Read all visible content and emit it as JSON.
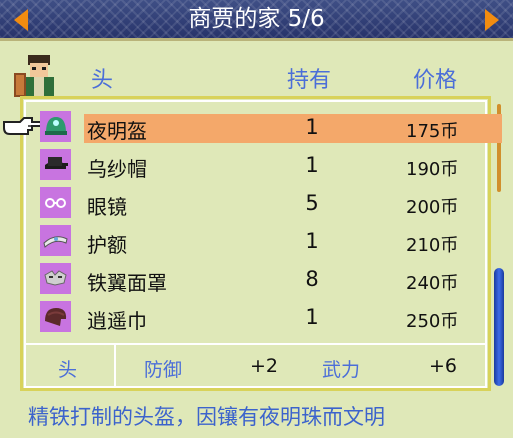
{
  "title": "商贾的家 5/6",
  "header": {
    "category": "头",
    "have_label": "持有",
    "price_label": "价格"
  },
  "items": [
    {
      "name": "夜明盔",
      "qty": "1",
      "price": "175",
      "unit": "币",
      "icon": "helmet-icon",
      "selected": true
    },
    {
      "name": "乌纱帽",
      "qty": "1",
      "price": "190",
      "unit": "币",
      "icon": "hat-icon"
    },
    {
      "name": "眼镜",
      "qty": "5",
      "price": "200",
      "unit": "币",
      "icon": "glasses-icon"
    },
    {
      "name": "护额",
      "qty": "1",
      "price": "210",
      "unit": "币",
      "icon": "headband-icon"
    },
    {
      "name": "铁翼面罩",
      "qty": "8",
      "price": "240",
      "unit": "币",
      "icon": "mask-icon"
    },
    {
      "name": "逍遥巾",
      "qty": "1",
      "price": "250",
      "unit": "币",
      "icon": "turban-icon"
    }
  ],
  "stats": {
    "slot": "头",
    "defense_label": "防御",
    "defense_value": "+2",
    "attack_label": "武力",
    "attack_value": "+6"
  },
  "description": "精铁打制的头盔，因镶有夜明珠而文明",
  "colors": {
    "title_bg": "#2f3c78",
    "accent": "#4b6ed8",
    "selected_row": "#f4a86a",
    "icon_bg": "#c874e0",
    "arrow": "#f28c10"
  }
}
